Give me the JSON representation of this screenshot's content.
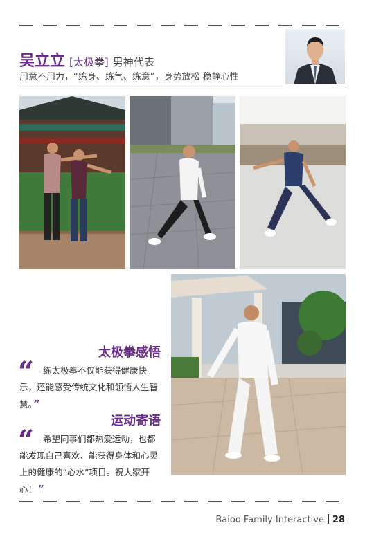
{
  "header": {
    "name": "吴立立",
    "category": "[太极拳]",
    "role": "男神代表",
    "motto": "用意不用力，“练身、练气、练意”，身势放松  稳静心性"
  },
  "sections": [
    {
      "title": "太极拳感悟",
      "text": "练太极拳不仅能获得健康快乐，还能感受传统文化和领悟人生智慧。"
    },
    {
      "title": "运动寄语",
      "text": "希望同事们都热爱运动，也都能发现自己喜欢、能获得身体和心灵上的健康的“心水”项目。祝大家开心！"
    }
  ],
  "footer": {
    "company": "Baioo Family Interactive",
    "page_number": "28"
  },
  "colors": {
    "accent": "#6a2c8c"
  }
}
